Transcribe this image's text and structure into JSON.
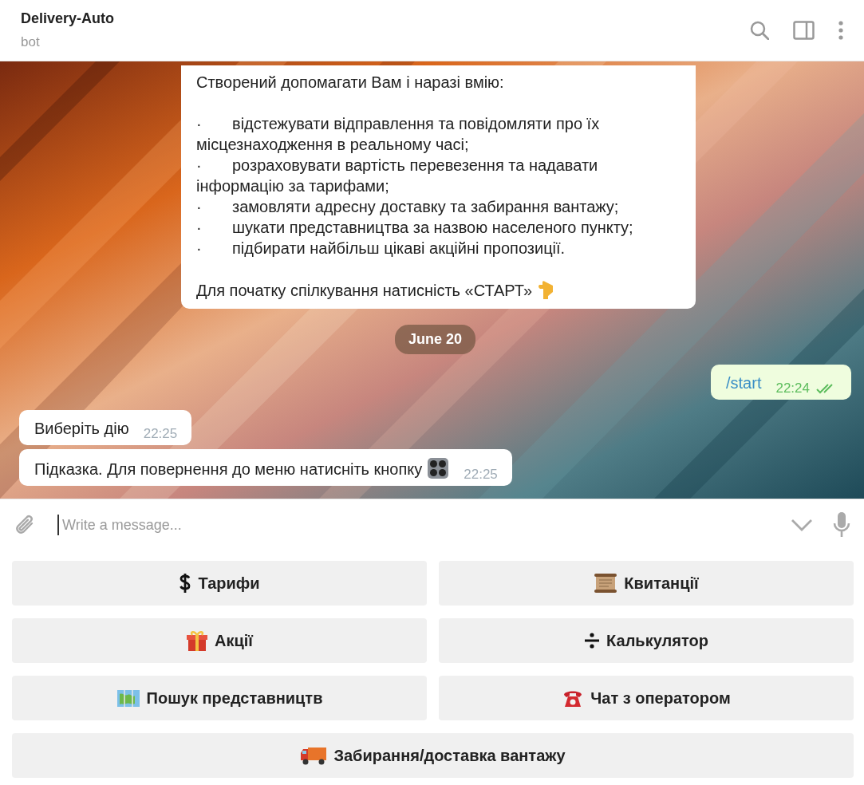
{
  "header": {
    "title": "Delivery-Auto",
    "subtitle": "bot"
  },
  "messages": [
    {
      "kind": "incoming",
      "paragraphs": [
        {
          "kind": "text",
          "text": "Створений допомагати Вам і наразі вмію:"
        },
        {
          "kind": "blank"
        },
        {
          "kind": "bullet",
          "bullet": "·",
          "text": "відстежувати відправлення та повідомляти про їх місцезнаходження в реальному часі;"
        },
        {
          "kind": "bullet",
          "bullet": "·",
          "text": "розраховувати вартість перевезення та надавати інформацію за тарифами;"
        },
        {
          "kind": "bullet",
          "bullet": "·",
          "text": "замовляти адресну доставку та забирання вантажу;"
        },
        {
          "kind": "bullet",
          "bullet": "·",
          "text": "шукати представництва за назвою населеного пункту;"
        },
        {
          "kind": "bullet",
          "bullet": "·",
          "text": "підбирати найбільш цікаві акційні пропозиції."
        },
        {
          "kind": "blank"
        },
        {
          "kind": "text",
          "text": "Для початку спілкування натисність «СТАРТ»",
          "emoji": true
        }
      ]
    },
    {
      "kind": "date",
      "text": "June 20"
    },
    {
      "kind": "outgoing",
      "text": "/start",
      "time": "22:24",
      "read": true
    },
    {
      "kind": "incoming",
      "text": "Виберіть дію",
      "time": "22:25"
    },
    {
      "kind": "incoming",
      "text": "Підказка. Для повернення до меню натисніть кнопку",
      "time": "22:25",
      "emoji": true
    }
  ],
  "composer": {
    "placeholder": "Write a message..."
  },
  "keyboard": {
    "rows": [
      [
        {
          "label": "Тарифи"
        },
        {
          "label": "Квитанції"
        }
      ],
      [
        {
          "label": "Акції"
        },
        {
          "label": "Калькулятор"
        }
      ],
      [
        {
          "label": "Пошук представництв"
        },
        {
          "label": "Чат з оператором"
        }
      ],
      [
        {
          "label": "Забирання/доставка вантажу"
        }
      ]
    ]
  }
}
